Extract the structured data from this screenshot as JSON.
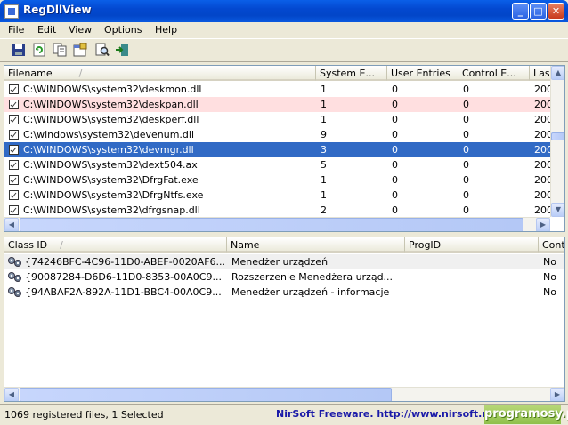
{
  "window": {
    "title": "RegDllView"
  },
  "menu": [
    "File",
    "Edit",
    "View",
    "Options",
    "Help"
  ],
  "toolbar": [
    "save-icon",
    "refresh-icon",
    "copy-icon",
    "properties-icon",
    "find-icon",
    "exit-icon"
  ],
  "files": {
    "columns": [
      "Filename",
      "System E...",
      "User Entries",
      "Control E...",
      "Las"
    ],
    "rows": [
      {
        "name": "C:\\WINDOWS\\system32\\deskmon.dll",
        "system": "1",
        "user": "0",
        "control": "0",
        "last": "200",
        "state": ""
      },
      {
        "name": "C:\\WINDOWS\\system32\\deskpan.dll",
        "system": "1",
        "user": "0",
        "control": "0",
        "last": "200",
        "state": "pink"
      },
      {
        "name": "C:\\WINDOWS\\system32\\deskperf.dll",
        "system": "1",
        "user": "0",
        "control": "0",
        "last": "200",
        "state": ""
      },
      {
        "name": "C:\\windows\\system32\\devenum.dll",
        "system": "9",
        "user": "0",
        "control": "0",
        "last": "200",
        "state": ""
      },
      {
        "name": "C:\\WINDOWS\\system32\\devmgr.dll",
        "system": "3",
        "user": "0",
        "control": "0",
        "last": "200",
        "state": "selected"
      },
      {
        "name": "C:\\WINDOWS\\system32\\dext504.ax",
        "system": "5",
        "user": "0",
        "control": "0",
        "last": "200",
        "state": ""
      },
      {
        "name": "C:\\WINDOWS\\system32\\DfrgFat.exe",
        "system": "1",
        "user": "0",
        "control": "0",
        "last": "200",
        "state": ""
      },
      {
        "name": "C:\\WINDOWS\\system32\\DfrgNtfs.exe",
        "system": "1",
        "user": "0",
        "control": "0",
        "last": "200",
        "state": ""
      },
      {
        "name": "C:\\WINDOWS\\system32\\dfrgsnap.dll",
        "system": "2",
        "user": "0",
        "control": "0",
        "last": "200",
        "state": ""
      }
    ]
  },
  "classes": {
    "columns": [
      "Class ID",
      "Name",
      "ProgID",
      "Cont"
    ],
    "rows": [
      {
        "id": "{74246BFC-4C96-11D0-ABEF-0020AF6...",
        "name": "Menedżer urządzeń",
        "progid": "",
        "cont": "No",
        "state": "gray"
      },
      {
        "id": "{90087284-D6D6-11D0-8353-00A0C9...",
        "name": "Rozszerzenie Menedżera urząd...",
        "progid": "",
        "cont": "No",
        "state": ""
      },
      {
        "id": "{94ABAF2A-892A-11D1-BBC4-00A0C9...",
        "name": "Menedżer urządzeń - informacje",
        "progid": "",
        "cont": "No",
        "state": ""
      }
    ]
  },
  "status": {
    "count": "1069 registered files, 1 Selected",
    "link": "NirSoft Freeware.  http://www.nirsoft.net",
    "badge": "programosy.pl"
  }
}
